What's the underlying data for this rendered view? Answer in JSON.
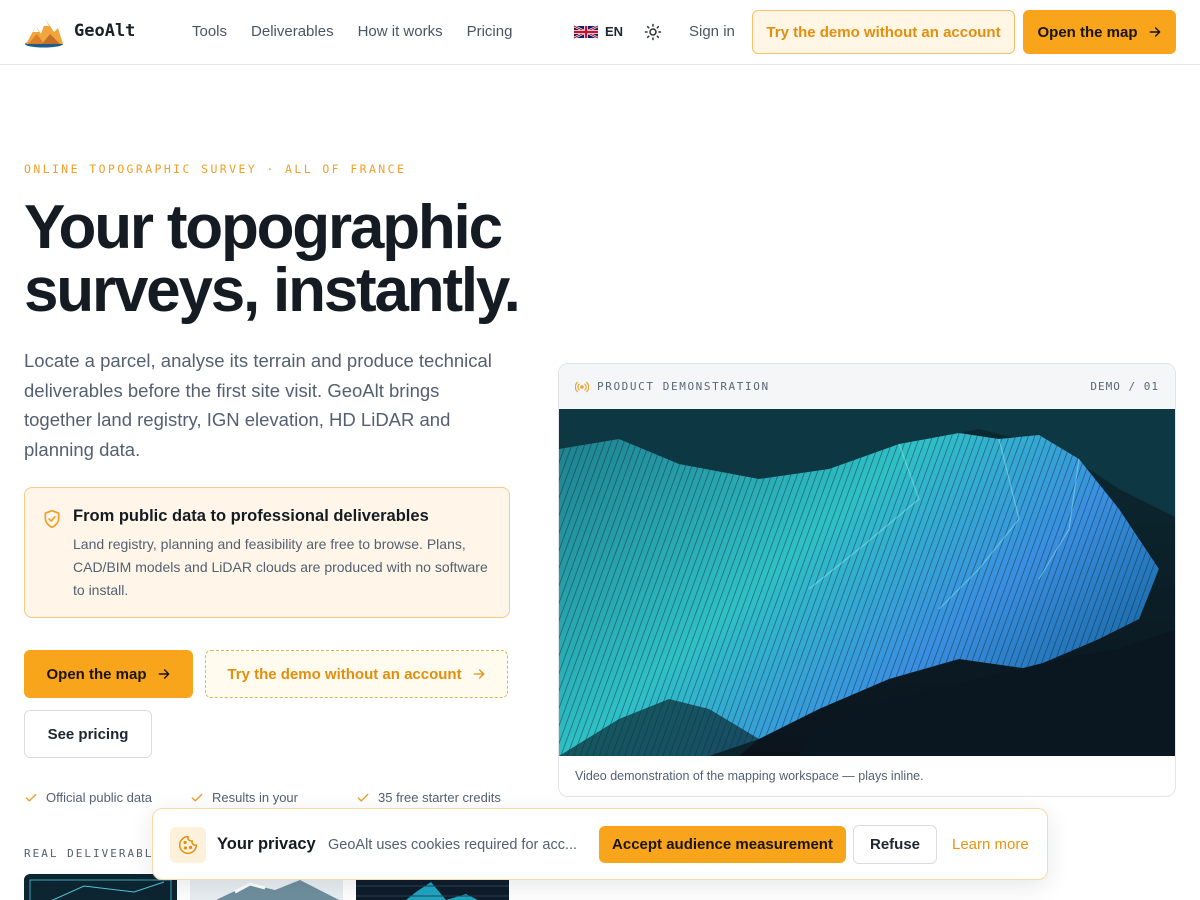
{
  "brand": {
    "name": "GeoAlt"
  },
  "nav": {
    "items": [
      "Tools",
      "Deliverables",
      "How it works",
      "Pricing"
    ]
  },
  "header": {
    "lang": "EN",
    "sign_in": "Sign in",
    "demo_button": "Try the demo without an account",
    "map_button": "Open the map"
  },
  "hero": {
    "eyebrow": "ONLINE TOPOGRAPHIC SURVEY · ALL OF FRANCE",
    "title_line1": "Your topographic",
    "title_line2": "surveys, instantly.",
    "lead": "Locate a parcel, analyse its terrain and produce technical deliverables before the first site visit. GeoAlt brings together land registry, IGN elevation, HD LiDAR and planning data.",
    "callout_title": "From public data to professional deliverables",
    "callout_body": "Land registry, planning and feasibility are free to browse. Plans, CAD/BIM models and LiDAR clouds are produced with no software to install.",
    "cta_map": "Open the map",
    "cta_demo": "Try the demo without an account",
    "cta_pricing": "See pricing",
    "checks": [
      "Official public data",
      "Results in your",
      "35 free starter credits"
    ],
    "deliverables_label": "REAL DELIVERABLES"
  },
  "demo_card": {
    "label": "PRODUCT DEMONSTRATION",
    "counter": "DEMO / 01",
    "caption": "Video demonstration of the mapping workspace — plays inline."
  },
  "cookie": {
    "title": "Your privacy",
    "text": "GeoAlt uses cookies required for acc...",
    "accept": "Accept audience measurement",
    "refuse": "Refuse",
    "learn_more": "Learn more"
  },
  "colors": {
    "accent": "#f9a51c",
    "accent_text": "#e38e0c",
    "ink": "#151b23",
    "muted": "#546071"
  },
  "icons": [
    "mountain-logo-icon",
    "uk-flag-icon",
    "sun-icon",
    "arrow-right-icon",
    "shield-check-icon",
    "check-icon",
    "broadcast-icon",
    "cookie-icon"
  ]
}
